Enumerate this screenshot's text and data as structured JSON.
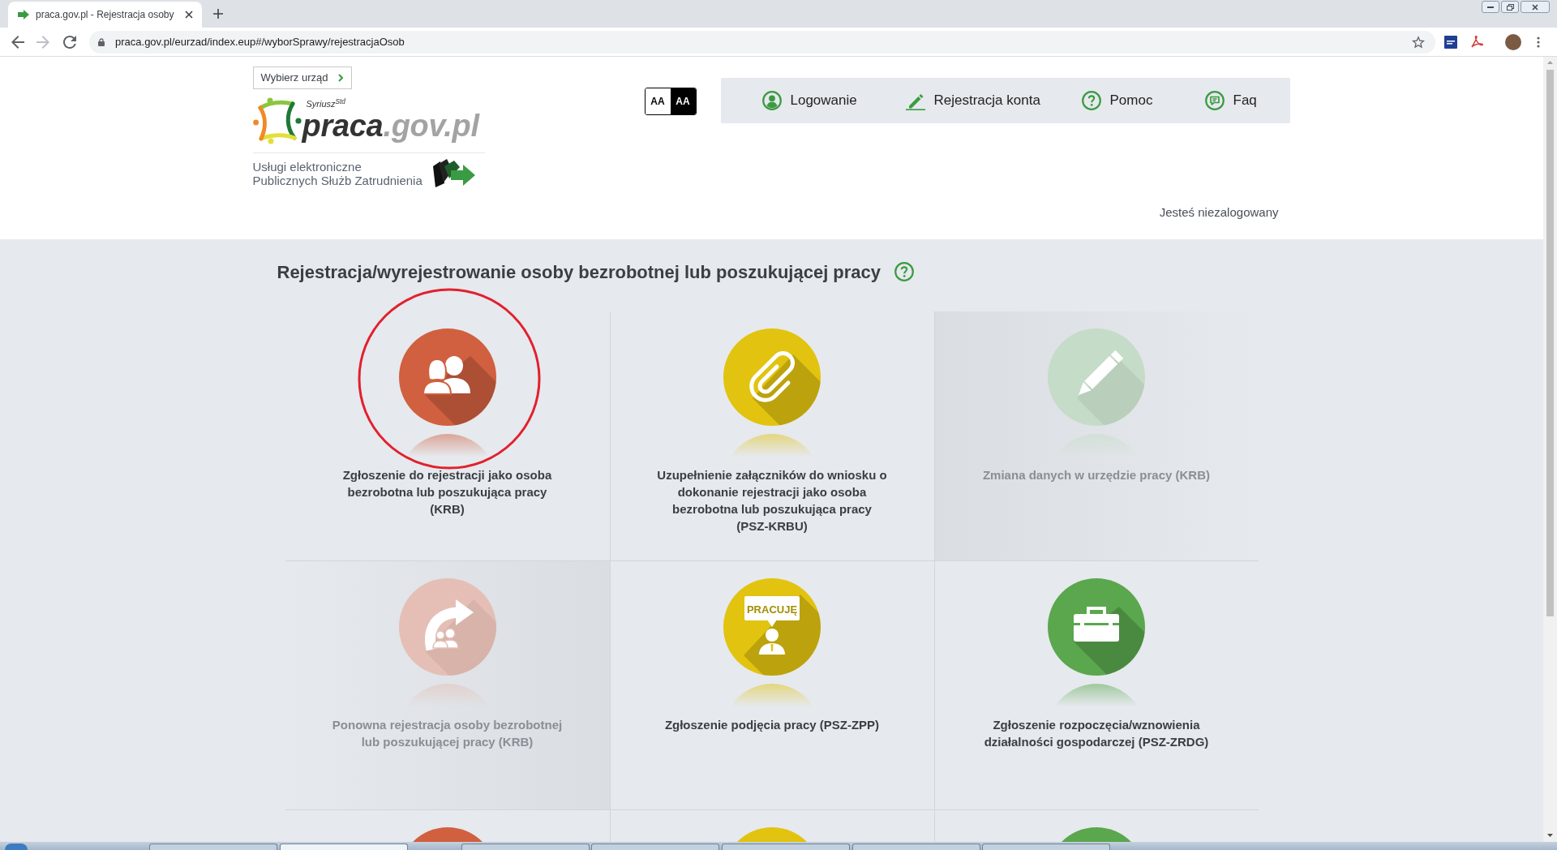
{
  "browser": {
    "tabs": [
      {
        "title": "praca.gov.pl - Rejestracja osoby",
        "selected": true
      }
    ],
    "nav_buttons": [
      {
        "kind": "back",
        "disabled": false
      },
      {
        "kind": "forward",
        "disabled": true
      },
      {
        "kind": "reload",
        "disabled": false
      }
    ],
    "url": "praca.gov.pl/eurzad/index.eup#/wyborSprawy/rejestracjaOsob"
  },
  "header": {
    "office_button": "Wybierz urząd",
    "logo": {
      "subtitle": "Syriusz$^{Std}$",
      "name": "praca",
      "domain": ".gov.pl"
    },
    "tagline": "Usługi elektroniczne\nPublicznych Służb Zatrudnienia",
    "contrast_buttons": [
      {
        "label": "AA",
        "kind": "normal"
      },
      {
        "label": "AA",
        "kind": "contrast"
      }
    ],
    "nav": [
      {
        "label": "Logowanie",
        "kind": "login"
      },
      {
        "label": "Rejestracja konta",
        "kind": "register"
      },
      {
        "label": "Pomoc",
        "kind": "help"
      },
      {
        "label": "Faq",
        "kind": "faq"
      }
    ],
    "login_status": "Jesteś niezalogowany"
  },
  "main": {
    "heading": "Rejestracja/wyrejestrowanie osoby bezrobotnej lub poszukującej pracy",
    "tiles": [
      {
        "label": "Zgłoszenie do rejestracji jako osoba\nbezrobotna lub poszukująca pracy\n(KRB)",
        "kind": "people",
        "color": "#d0603f",
        "disabled": false
      },
      {
        "label": "Uzupełnienie załączników do wniosku o\ndokonanie rejestracji jako osoba\nbezrobotna lub poszukująca pracy\n(PSZ-KRBU)",
        "kind": "attachment",
        "color": "#e2c30f",
        "disabled": false
      },
      {
        "label": "Zmiana danych w urzędzie pracy (KRB)",
        "kind": "edit",
        "color": "#c5dcc8",
        "disabled": true
      },
      {
        "label": "Ponowna rejestracja osoby bezrobotnej\nlub poszukującej pracy (KRB)",
        "kind": "reregister",
        "color": "#e5bfb5",
        "disabled": true
      },
      {
        "label": "Zgłoszenie podjęcia pracy (PSZ-ZPP)",
        "kind": "employment",
        "badge": "PRACUJĘ",
        "color": "#e2c30f",
        "disabled": false
      },
      {
        "label": "Zgłoszenie rozpoczęcia/wznowienia\ndziałalności gospodarczej (PSZ-ZRDG)",
        "kind": "business",
        "color": "#5aa74e",
        "disabled": false
      },
      {
        "color": "#d0603f",
        "disabled": false
      },
      {
        "color": "#e2c30f",
        "disabled": false
      },
      {
        "color": "#5aa74e",
        "disabled": false
      }
    ]
  },
  "taskbar": {
    "buttons": [
      {
        "selected": false
      },
      {
        "selected": true
      },
      {
        "selected": false
      },
      {
        "selected": false
      },
      {
        "selected": false
      },
      {
        "selected": false
      },
      {
        "selected": false
      }
    ]
  }
}
